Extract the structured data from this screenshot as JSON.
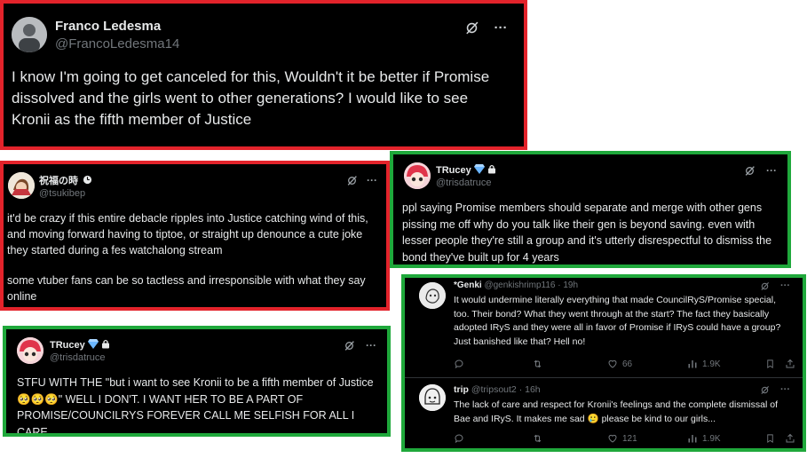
{
  "tweet1": {
    "name": "Franco Ledesma",
    "handle": "@FrancoLedesma14",
    "text": "I know I'm going to get canceled for this, Wouldn't it be better if Promise dissolved and the girls went to other generations? I would like to see Kronii as the fifth member of Justice"
  },
  "tweet2": {
    "name": "祝福の時",
    "handle": "@tsukibep",
    "text_p1": "it'd be crazy if this entire debacle ripples into Justice catching wind of this, and moving forward having to tiptoe, or straight up denounce a cute joke they started during a fes watchalong stream",
    "text_p2": "some vtuber fans can be so tactless and irresponsible with what they say online"
  },
  "tweet3": {
    "name": "TRucey",
    "handle": "@trisdatruce",
    "text": "ppl saying Promise members should separate and merge with other gens pissing me off why do you talk like their gen is beyond saving. even with lesser people they're still a group and it's utterly disrespectful to dismiss the bond they've built up for 4 years"
  },
  "tweet4": {
    "name": "TRucey",
    "handle": "@trisdatruce",
    "text_line1": "STFU WITH THE \"but i want to see Kronii to be a fifth member of Justice",
    "text_line1b": "\" WELL I DON'T. I WANT HER TO BE A PART OF PROMISE/COUNCILRYS FOREVER CALL ME SELFISH FOR ALL I CARE.",
    "emoji": "🥺🥺🥺"
  },
  "tweet5": {
    "name": "*Genki",
    "handle": "@genkishrimp116 · 19h",
    "text": "It would undermine literally everything that made CouncilRyS/Promise special, too. Their bond? What they went through at the start? The fact they basically adopted IRyS and they were all in favor of Promise if IRyS could have a group? Just banished like that? Hell no!",
    "likes": "66",
    "views": "1.9K"
  },
  "tweet6": {
    "name": "trip",
    "handle": "@tripsout2 · 16h",
    "text_a": "The lack of care and respect for Kronii's feelings and the complete dismissal of Bae and IRyS. It makes me sad",
    "text_b": "please be kind to our girls...",
    "emoji": "🥲",
    "likes": "121",
    "views": "1.9K"
  },
  "colors": {
    "red_border": "#e3232b",
    "green_border": "#1fa83b",
    "verified_blue": "#1d9bf0"
  }
}
